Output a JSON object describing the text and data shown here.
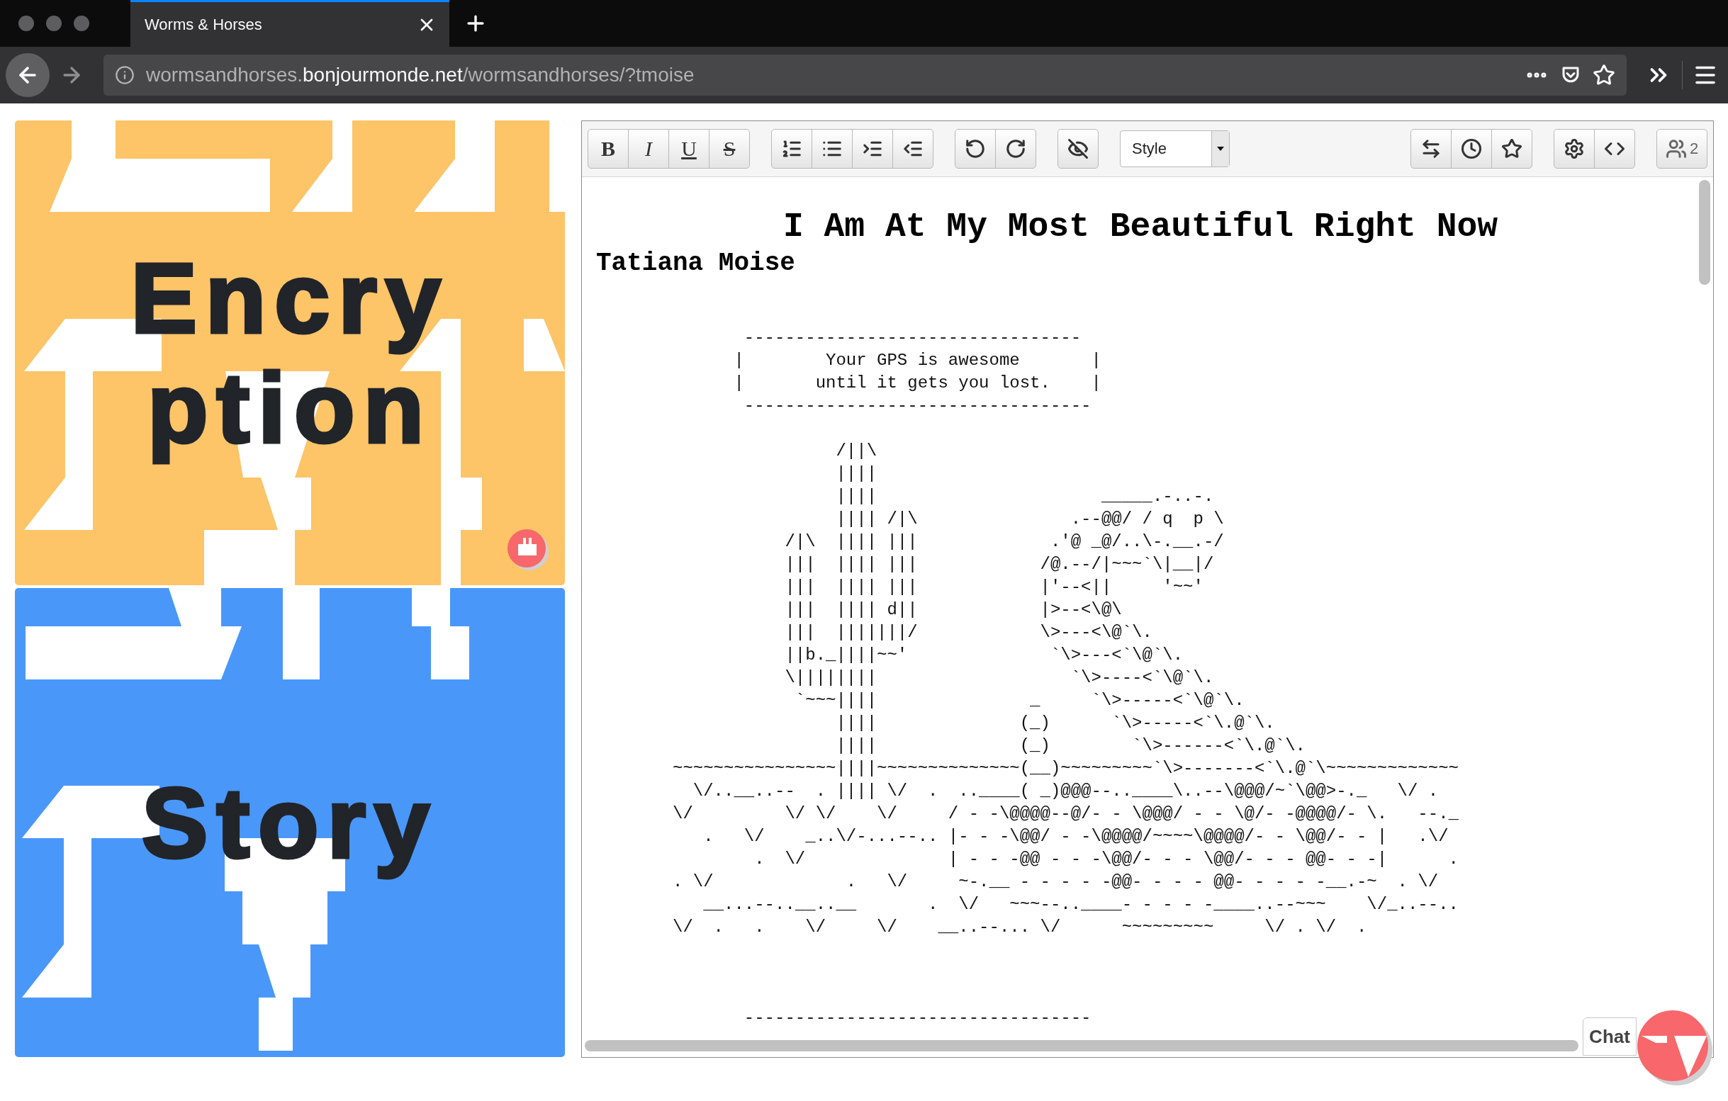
{
  "browser": {
    "tab": {
      "title": "Worms & Horses",
      "selected": true
    },
    "url_parts": [
      {
        "text": "wormsandhorses.",
        "emphasis": false
      },
      {
        "text": "bonjourmonde.net",
        "emphasis": true
      },
      {
        "text": "/wormsandhorses/?tmoise",
        "emphasis": false
      }
    ]
  },
  "cards": [
    {
      "color": "#fdc468",
      "words": [
        "Encry",
        "ption"
      ],
      "badge": true
    },
    {
      "color": "#4a97fa",
      "words": [
        "Story"
      ],
      "badge": false
    }
  ],
  "editor": {
    "toolbar": {
      "format_buttons": [
        {
          "label": "B",
          "kind": "bold"
        },
        {
          "label": "I",
          "kind": "italic"
        },
        {
          "label": "U",
          "kind": "underline"
        },
        {
          "label": "S",
          "kind": "strike"
        }
      ],
      "style_select": "Style",
      "users_count": "2"
    },
    "document": {
      "title": "I Am At My Most Beautiful Right Now",
      "author": "Tatiana Moise",
      "blocks": [
        [
          "       ---------------------------------",
          "      |        Your GPS is awesome       |",
          "      |       until it gets you lost.    |",
          "       ----------------------------------"
        ],
        [
          "                /||\\",
          "                ||||",
          "                ||||                      _____.-..-.",
          "                |||| /|\\               .--@@/ / q  p \\",
          "           /|\\  |||| |||             .'@ _@/..\\-.__.-/",
          "           |||  |||| |||            /@.--/|~~~`\\|__|/",
          "           |||  |||| |||            |'--<||     '~~'",
          "           |||  |||| d||            |>--<\\@\\",
          "           |||  |||||||/            \\>---<\\@`\\.",
          "           ||b._||||~~'              `\\>---<`\\@`\\.",
          "           \\||||||||                   `\\>----<`\\@`\\.",
          "            `~~~||||               _     `\\>-----<`\\@`\\.",
          "                ||||              (_)      `\\>-----<`\\.@`\\.",
          "                ||||              (_)        `\\>------<`\\.@`\\.",
          "~~~~~~~~~~~~~~~~||||~~~~~~~~~~~~~~(__)~~~~~~~~~`\\>-------<`\\.@`\\~~~~~~~~~~~~~",
          "  \\/..__..--  . |||| \\/  .  ..____( _)@@@--..____\\..--\\@@@/~`\\@@>-._   \\/ .",
          "\\/         \\/ \\/    \\/     / - -\\@@@@--@/- - \\@@@/ - - \\@/- -@@@@/- \\.   --._",
          "   .   \\/    _..\\/-...--.. |- - -\\@@/ - -\\@@@@/~~~~\\@@@@/- - \\@@/- - |   .\\/",
          "        .  \\/              | - - -@@ - - -\\@@/- - - \\@@/- - - @@- - -|      .",
          ". \\/             .   \\/     ~-.__ - - - - -@@- - - - @@- - - - -__.-~  . \\/",
          "   __...--..__..__       .  \\/   ~~~--..____- - - - -____..--~~~    \\/_..--..",
          "\\/  .   .    \\/     \\/    __..--... \\/      ~~~~~~~~~     \\/ . \\/  ."
        ],
        [
          "       ----------------------------------"
        ]
      ]
    },
    "chat_button": "Chat"
  }
}
